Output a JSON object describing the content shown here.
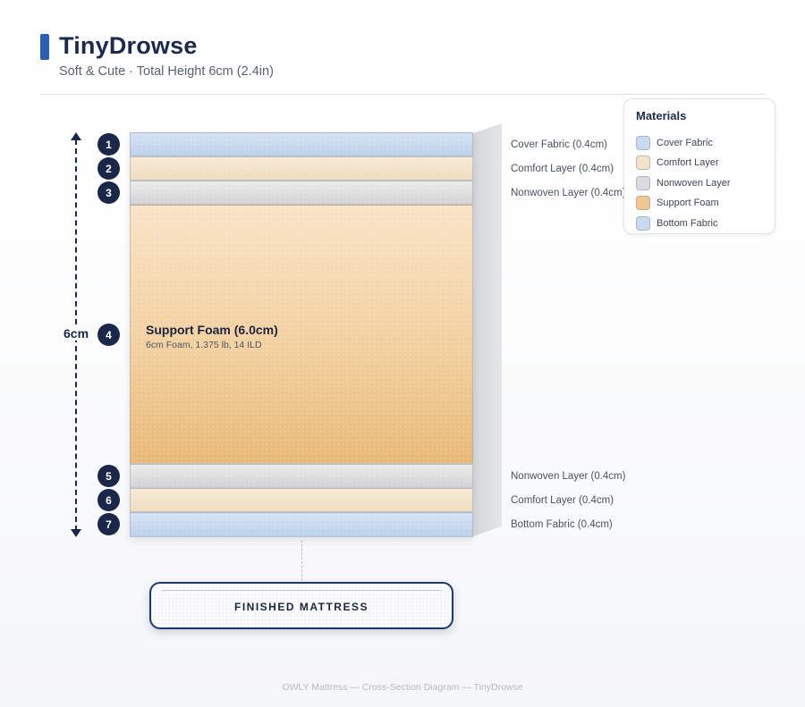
{
  "header": {
    "title": "TinyDrowse",
    "subtitle": "Soft & Cute · Total Height 6cm (2.4in)"
  },
  "dimension": {
    "label": "6cm"
  },
  "layers": [
    {
      "number": "1",
      "name": "Cover Fabric",
      "label": "Cover Fabric (0.4cm)"
    },
    {
      "number": "2",
      "name": "Comfort Layer",
      "label": "Comfort Layer (0.4cm)"
    },
    {
      "number": "3",
      "name": "Nonwoven Layer",
      "label": "Nonwoven Layer (0.4cm)"
    },
    {
      "number": "4",
      "name": "Support Foam",
      "title": "Support Foam (6.0cm)",
      "description": "6cm Foam, 1.375 lb, 14 ILD"
    },
    {
      "number": "5",
      "name": "Nonwoven Layer",
      "label": "Nonwoven Layer (0.4cm)"
    },
    {
      "number": "6",
      "name": "Comfort Layer",
      "label": "Comfort Layer (0.4cm)"
    },
    {
      "number": "7",
      "name": "Bottom Fabric",
      "label": "Bottom Fabric (0.4cm)"
    }
  ],
  "legend": {
    "title": "Materials",
    "items": [
      {
        "label": "Cover Fabric",
        "color": "#c9d9ef"
      },
      {
        "label": "Comfort Layer",
        "color": "#f3e3c8"
      },
      {
        "label": "Nonwoven Layer",
        "color": "#dcdcde"
      },
      {
        "label": "Support Foam",
        "color": "#f0c78e"
      },
      {
        "label": "Bottom Fabric",
        "color": "#c9d9ef"
      }
    ]
  },
  "finished": {
    "label": "FINISHED MATTRESS"
  },
  "footer": "OWLY Mattress — Cross-Section Diagram — TinyDrowse",
  "colors": {
    "accent": "#2d5fb0",
    "badge": "#1a2748"
  }
}
